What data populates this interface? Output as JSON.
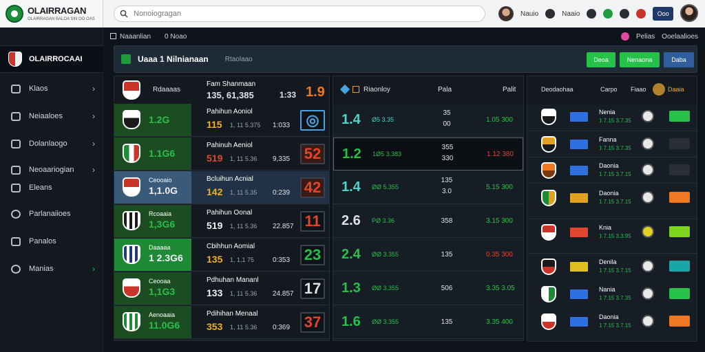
{
  "brand": {
    "title": "OLAIRRAGAN",
    "subtitle": "OLAIRRAGAN BALOA SIN OO OAS"
  },
  "search": {
    "placeholder": "Nonoiogragan"
  },
  "topbar": {
    "user_label": "Nauio",
    "link1": "Naaio",
    "button_label": "Ooo"
  },
  "sidebar": {
    "title": "OLAIRROCAAI",
    "items": [
      {
        "label": "Klaos",
        "icon": "shield-icon"
      },
      {
        "label": "Neiaaloes",
        "icon": "monitor-icon"
      },
      {
        "label": "Dolanlaogo",
        "icon": "lock-icon"
      },
      {
        "label": "Neoaariogian",
        "icon": "folder-icon"
      },
      {
        "label": "Eleans",
        "icon": "list-icon"
      },
      {
        "label": "Parlanaiioes",
        "icon": "clock-icon"
      },
      {
        "label": "Panalos",
        "icon": "puzzle-icon"
      },
      {
        "label": "Manias",
        "icon": "phone-icon"
      }
    ]
  },
  "subbar": {
    "left1": "Naaanlian",
    "left2": "0 Noao",
    "right1": "Pelias",
    "right2": "Ooelaalioes"
  },
  "panel": {
    "title": "Uaaa 1 Nilnianaan",
    "subtitle": "Rtaolaao",
    "btn1": "Deoa",
    "btn2": "Nenaona",
    "btn3": "Daba"
  },
  "col1": {
    "header": {
      "label": "Rdaaaas",
      "name": "Fam Shanmaan",
      "score": "135, 61,385",
      "mid": "1:33",
      "big": "1.9"
    },
    "rows": [
      {
        "odds": "1.2G",
        "name": "Pahihun Aoniol",
        "score": "115",
        "dots": "1, 11 5.375",
        "mid": "1:033",
        "box": "◎",
        "box_color": "#4aa3e0"
      },
      {
        "odds": "1.1G6",
        "name": "Pahinuh Aeniol",
        "score": "519",
        "dots": "1, 11 5.36",
        "mid": "9,335",
        "box": "52",
        "box_color": "#e0462e"
      },
      {
        "odds": "1,1.0G",
        "label": "Ceooaio",
        "name": "Bcluihun Acnial",
        "score": "142",
        "dots": "1, 11 5.35",
        "mid": "0:239",
        "box": "42",
        "box_color": "#e0462e"
      },
      {
        "odds": "1,3G6",
        "label": "Rcoaaia",
        "name": "Pahihun Oonal",
        "score": "519",
        "dots": "1, 11 5.36",
        "mid": "22.857",
        "box": "11",
        "box_color": "#e0462e"
      },
      {
        "odds": "1 2.3G6",
        "label": "Daaaaa",
        "name": "Cbihhun Aomial",
        "score": "135",
        "dots": "1, 1,1 75",
        "mid": "0:353",
        "box": "23",
        "box_color": "#27c04a"
      },
      {
        "odds": "1,1G3",
        "label": "Ceooaa",
        "name": "Pdhuhan Mananl",
        "score": "133",
        "dots": "1, 11 5.36",
        "mid": "24.857",
        "box": "17",
        "box_color": "#dfe3e8"
      },
      {
        "odds": "11.0G6",
        "label": "Aenoaaia",
        "name": "Pdihihan Menaal",
        "score": "353",
        "dots": "1, 11 5.36",
        "mid": "0:369",
        "box": "37",
        "box_color": "#e0462e"
      }
    ]
  },
  "col2": {
    "header": {
      "label": "Riaonloy",
      "mid": "Pala",
      "right": "Palit"
    },
    "rows": [
      {
        "big": "1.4",
        "a": "Ø5 3.35",
        "b1": "35",
        "b2": "00",
        "c": "1.05  300",
        "big_color": "#4ad6c8",
        "a_color": "#4ad6c8",
        "c_color": "#27c04a"
      },
      {
        "big": "1.2",
        "a": "1Ø5 3.383",
        "b1": "355",
        "b2": "330",
        "c": "1.12  380",
        "big_color": "#27c04a",
        "a_color": "#27c04a",
        "c_color": "#e0462e"
      },
      {
        "big": "1.4",
        "a": "ØØ 5.355",
        "b1": "135",
        "b2": "3.0",
        "c": "5.15  300",
        "big_color": "#4ad6c8",
        "a_color": "#27c04a",
        "c_color": "#27c04a"
      },
      {
        "big": "2.6",
        "a": "PØ 3.36",
        "b1": "358",
        "b2": "",
        "c": "3.15  300",
        "big_color": "#dfe3e8",
        "a_color": "#27c04a",
        "c_color": "#27c04a"
      },
      {
        "big": "2.4",
        "a": "ØØ 3.355",
        "b1": "135",
        "b2": "",
        "c": "0.35  300",
        "big_color": "#27c04a",
        "a_color": "#27c04a",
        "c_color": "#e0462e"
      },
      {
        "big": "1.3",
        "a": "ØØ 3.355",
        "b1": "506",
        "b2": "",
        "c": "3.35  3.05",
        "big_color": "#27c04a",
        "a_color": "#27c04a",
        "c_color": "#27c04a"
      },
      {
        "big": "1.6",
        "a": "ØØ 3.355",
        "b1": "135",
        "b2": "",
        "c": "3.35  400",
        "big_color": "#27c04a",
        "a_color": "#27c04a",
        "c_color": "#27c04a"
      }
    ]
  },
  "col3": {
    "header": {
      "label1": "Deodaohaa",
      "label2": "Carpo",
      "label3": "Fiaao",
      "label4": "Daaia"
    },
    "rows": [
      {
        "name": "Nenia",
        "sub": "1 7.15 3.7.35",
        "flag_color": "#2f6fe0",
        "btn_color": "#27c04a"
      },
      {
        "name": "Fanna",
        "sub": "1 7.15 3.7.35",
        "flag_color": "#2f6fe0",
        "btn_color": "#2b2f35"
      },
      {
        "name": "Daonia",
        "sub": "1 7.15 3.7.15",
        "flag_color": "#2f6fe0",
        "btn_color": "#2b2f35"
      },
      {
        "name": "Daonia",
        "sub": "1 7.15 3.7.15",
        "flag_color": "#e0a020",
        "btn_color": "#f07820"
      },
      {
        "name": "Knia",
        "sub": "1 7.15 3.3.95",
        "flag_color": "#e0462e",
        "btn_color": "#7ed321"
      },
      {
        "name": "Denila",
        "sub": "1 7.15 3.7.15",
        "flag_color": "#e0c020",
        "btn_color": "#1aa6a6"
      },
      {
        "name": "Nania",
        "sub": "1 7.15 3.7.35",
        "flag_color": "#2f6fe0",
        "btn_color": "#27c04a"
      },
      {
        "name": "Daonia",
        "sub": "1 7.15 3.7.15",
        "flag_color": "#2f6fe0",
        "btn_color": "#f07820"
      }
    ]
  }
}
